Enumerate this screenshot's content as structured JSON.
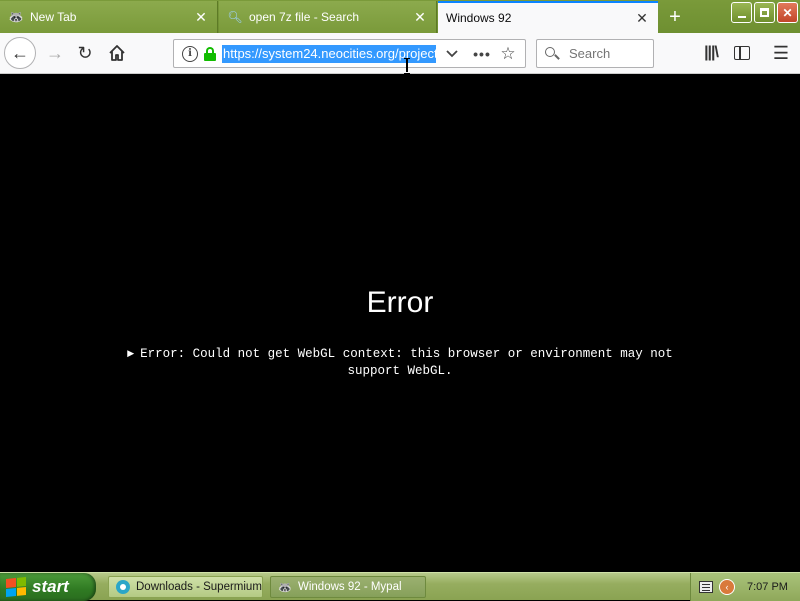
{
  "tabs": [
    {
      "label": "New Tab",
      "icon": "raccoon-icon",
      "state": "inactive"
    },
    {
      "label": "open 7z file - Search",
      "icon": "search-icon",
      "state": "inactive"
    },
    {
      "label": "Windows 92",
      "icon": "",
      "state": "active"
    }
  ],
  "window_controls": {
    "minimize": "minimize",
    "maximize": "maximize",
    "close": "close"
  },
  "toolbar": {
    "url": "https://system24.neocities.org/project",
    "search_placeholder": "Search"
  },
  "page": {
    "error_title": "Error",
    "error_message_line1": "Error: Could not get WebGL context: this browser or environment may not",
    "error_message_line2": "support WebGL."
  },
  "taskbar": {
    "start_label": "start",
    "tasks": [
      {
        "label": "Downloads - Supermium",
        "icon": "supermium-icon"
      },
      {
        "label": "Windows 92 - Mypal",
        "icon": "raccoon-icon"
      }
    ],
    "clock": "7:07 PM"
  },
  "colors": {
    "tabstrip": "#7a9a3a",
    "active_tab_accent": "#0a84ff",
    "url_selection": "#3399ff",
    "lock_green": "#12bc00",
    "page_background": "#000000",
    "start_button": "#2f7a22"
  }
}
